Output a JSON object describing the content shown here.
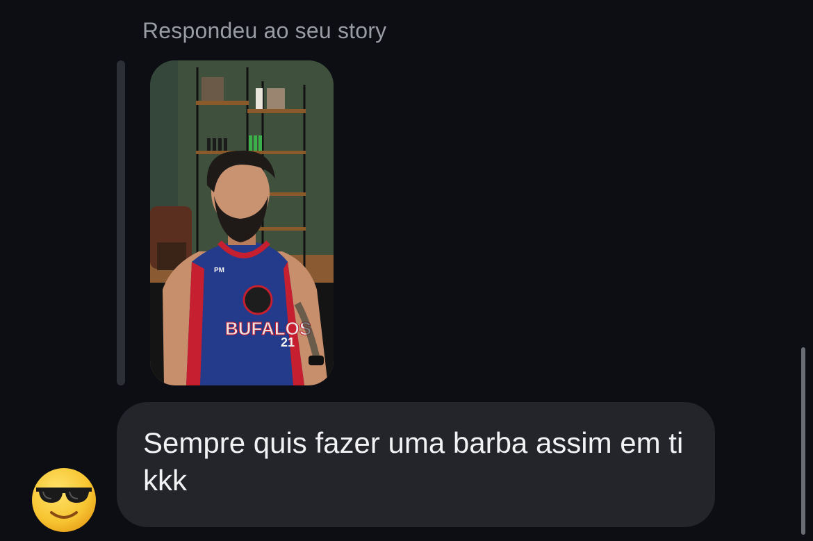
{
  "reply": {
    "caption": "Respondeu ao seu story"
  },
  "story": {
    "jersey_team_text": "BUFALOS",
    "jersey_number": "21",
    "jersey_brand": "PM"
  },
  "message": {
    "text": "Sempre quis fazer uma barba assim em ti kkk"
  },
  "sender": {
    "avatar_icon": "smiling-face-with-sunglasses-emoji"
  },
  "colors": {
    "background": "#0c0e14",
    "bubble": "#23252b",
    "caption": "#9a9ca3",
    "message_text": "#f2f2f4"
  }
}
